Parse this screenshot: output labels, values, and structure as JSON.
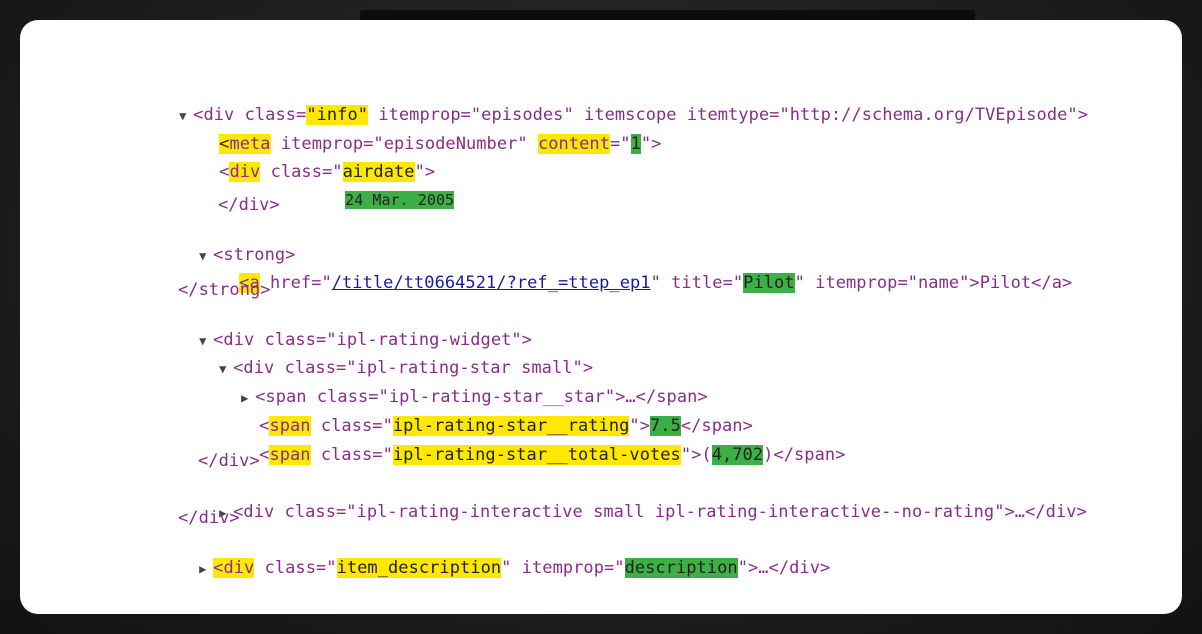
{
  "lines": {
    "l1": {
      "tag": "div",
      "attr_class": "class=",
      "q1": "\"",
      "class_val": "info",
      "q2": "\"",
      "rest": " itemprop=\"episodes\" itemscope itemtype=\"http://schema.org/TVEpisode\">"
    },
    "l2": {
      "open": "<",
      "tag": "meta",
      "rest1": " itemprop=\"episodeNumber\" ",
      "content": "content",
      "eq": "=\"",
      "num": "1",
      "close": "\">"
    },
    "l3": {
      "open": "<",
      "tag": "div",
      "mid": " class=\"",
      "val": "airdate",
      "close": "\">"
    },
    "l4": {
      "date": "24 Mar. 2005"
    },
    "l5": {
      "text": "</div>"
    },
    "l6": {
      "text": "<strong>"
    },
    "l7": {
      "open": "<",
      "tag": "a",
      "mid": " href=\"",
      "href": "/title/tt0664521/?ref_=ttep_ep1",
      "mid2": "\" title=\"",
      "title": "Pilot",
      "rest": "\" itemprop=\"name\">Pilot</a>"
    },
    "l8": {
      "text": "</strong>"
    },
    "l9": {
      "text": "<div class=\"ipl-rating-widget\">"
    },
    "l10": {
      "text": "<div class=\"ipl-rating-star small\">"
    },
    "l11": {
      "text": "<span class=\"ipl-rating-star__star\">…</span>"
    },
    "l12": {
      "open": "<",
      "tag": "span",
      "mid": " class=\"",
      "val": "ipl-rating-star__rating",
      "mid2": "\">",
      "rating": "7.5",
      "close": "</span>"
    },
    "l13": {
      "open": "<",
      "tag": "span",
      "mid": " class=\"",
      "val": "ipl-rating-star__total-votes",
      "mid2": "\">(",
      "votes": "4,702",
      "close": ")</span>"
    },
    "l14": {
      "text": "</div>"
    },
    "l15": {
      "text": "<div class=\"ipl-rating-interactive small ipl-rating-interactive--no-rating\">…</div>"
    },
    "l16": {
      "text": "</div>"
    },
    "l17": {
      "open": "<",
      "tag": "div",
      "mid": " class=\"",
      "val": "item_description",
      "mid2": "\" itemprop=\"",
      "desc": "description",
      "close": "\">…</div>"
    }
  },
  "colors": {
    "highlight_yellow": "#ffe800",
    "highlight_green": "#3cb044"
  },
  "icons": {
    "expanded": "triangle-down-icon",
    "collapsed": "triangle-right-icon"
  }
}
